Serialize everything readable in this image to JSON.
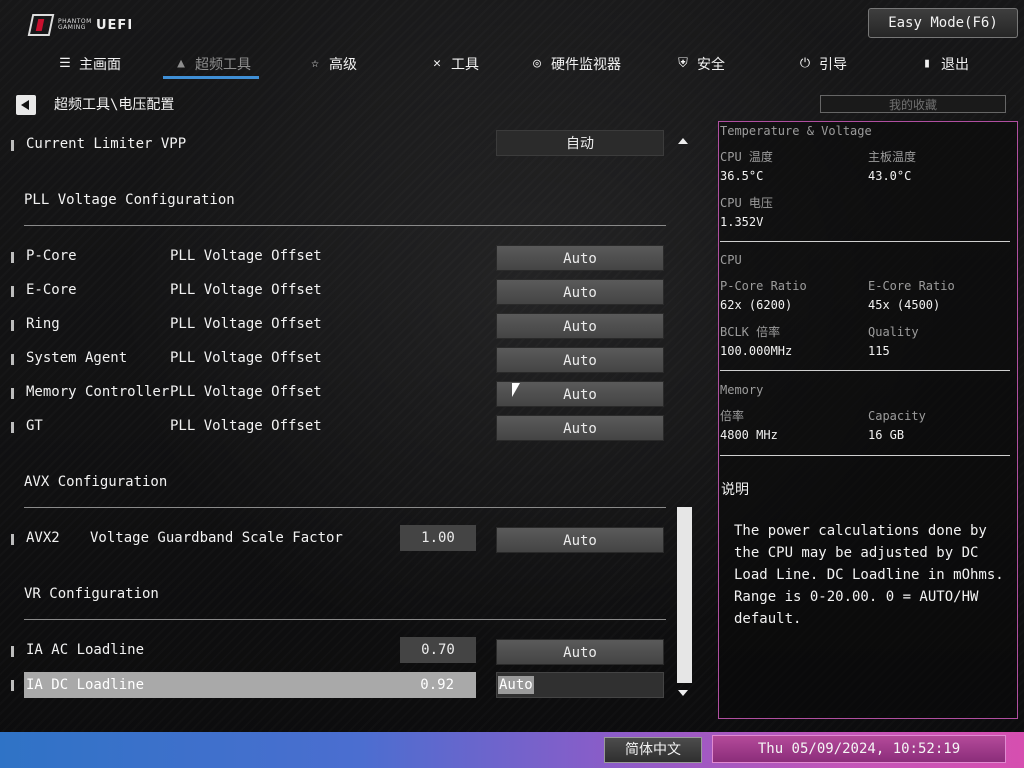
{
  "header": {
    "logo_sub": "PHANTOM GAMING",
    "logo_title": "UEFI",
    "easy_mode_label": "Easy Mode(F6)"
  },
  "nav": {
    "main": "主画面",
    "oc_tweaker": "超频工具",
    "advanced": "高级",
    "tools": "工具",
    "hw_monitor": "硬件监视器",
    "security": "安全",
    "boot": "引导",
    "exit": "退出"
  },
  "breadcrumb": "超频工具\\电压配置",
  "favorites": "我的收藏",
  "rows": {
    "current_limiter": {
      "label": "Current Limiter VPP",
      "value": "自动"
    },
    "pll_section": "PLL Voltage Configuration",
    "pll": [
      {
        "name": "P-Core",
        "desc": "PLL Voltage Offset",
        "value": "Auto"
      },
      {
        "name": "E-Core",
        "desc": "PLL Voltage Offset",
        "value": "Auto"
      },
      {
        "name": "Ring",
        "desc": "PLL Voltage Offset",
        "value": "Auto"
      },
      {
        "name": "System Agent",
        "desc": "PLL Voltage Offset",
        "value": "Auto"
      },
      {
        "name": "Memory Controller",
        "desc": "PLL Voltage Offset",
        "value": "Auto"
      },
      {
        "name": "GT",
        "desc": "PLL Voltage Offset",
        "value": "Auto"
      }
    ],
    "avx_section": "AVX Configuration",
    "avx2": {
      "name": "AVX2",
      "desc": "Voltage Guardband Scale Factor",
      "number": "1.00",
      "value": "Auto"
    },
    "vr_section": "VR Configuration",
    "ia_ac": {
      "label": "IA AC Loadline",
      "number": "0.70",
      "value": "Auto"
    },
    "ia_dc": {
      "label": "IA DC Loadline",
      "number": "0.92",
      "value": "Auto"
    }
  },
  "panel": {
    "title": "Temperature & Voltage",
    "cpu_temp_label": "CPU 温度",
    "cpu_temp_value": "36.5°C",
    "mb_temp_label": "主板温度",
    "mb_temp_value": "43.0°C",
    "cpu_volt_label": "CPU 电压",
    "cpu_volt_value": "1.352V",
    "cpu_header": "CPU",
    "pcore_ratio_label": "P-Core Ratio",
    "pcore_ratio_value": "62x (6200)",
    "ecore_ratio_label": "E-Core Ratio",
    "ecore_ratio_value": "45x (4500)",
    "bclk_label": "BCLK 倍率",
    "bclk_value": "100.000MHz",
    "quality_label": "Quality",
    "quality_value": "115",
    "memory_header": "Memory",
    "mem_ratio_label": "倍率",
    "mem_ratio_value": "4800 MHz",
    "capacity_label": "Capacity",
    "capacity_value": "16 GB",
    "desc_header": "说明",
    "description": "The power calculations done by the CPU may be adjusted by DC Load Line. DC Loadline in mOhms. Range is 0-20.00. 0 = AUTO/HW default."
  },
  "footer": {
    "language": "简体中文",
    "datetime": "Thu 05/09/2024, 10:52:19"
  },
  "colors": {
    "accent_blue": "#3f8fd6",
    "panel_border": "#b04fa0",
    "footer_start": "#2f73c6",
    "footer_end": "#d64fb0"
  }
}
